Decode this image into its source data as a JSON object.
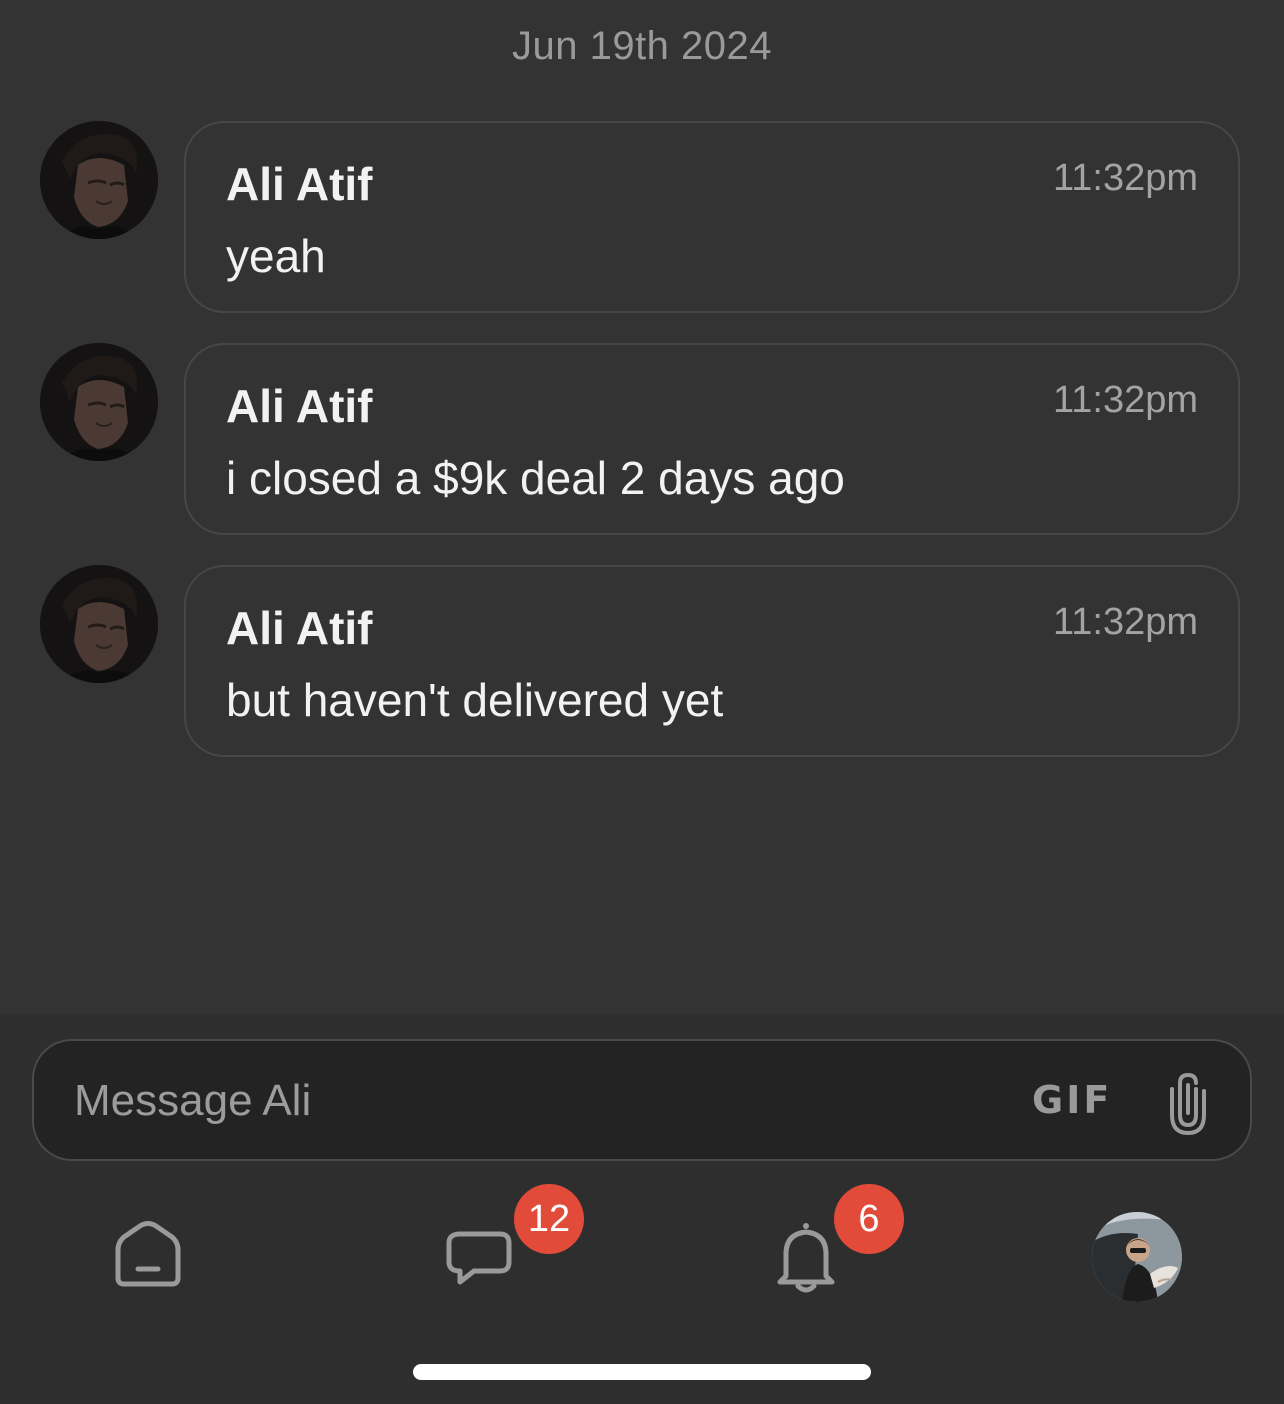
{
  "chat": {
    "date_separator": "Jun 19th 2024",
    "messages": [
      {
        "sender": "Ali Atif",
        "time": "11:32pm",
        "text": "yeah"
      },
      {
        "sender": "Ali Atif",
        "time": "11:32pm",
        "text": "i closed a $9k deal 2 days ago"
      },
      {
        "sender": "Ali Atif",
        "time": "11:32pm",
        "text": "but haven't delivered yet"
      }
    ]
  },
  "composer": {
    "placeholder": "Message Ali",
    "gif_label": "GIF",
    "attach_icon": "paperclip-icon"
  },
  "nav": {
    "home_icon": "home-icon",
    "messages_icon": "chat-bubble-icon",
    "messages_badge": "12",
    "notifications_icon": "bell-icon",
    "notifications_badge": "6",
    "profile_icon": "profile-avatar"
  },
  "colors": {
    "background": "#333333",
    "bubble_border": "#474747",
    "composer_background": "#232323",
    "badge": "#e24b3a",
    "text_primary": "#f2f2f2",
    "text_muted": "#9a9a9a"
  }
}
